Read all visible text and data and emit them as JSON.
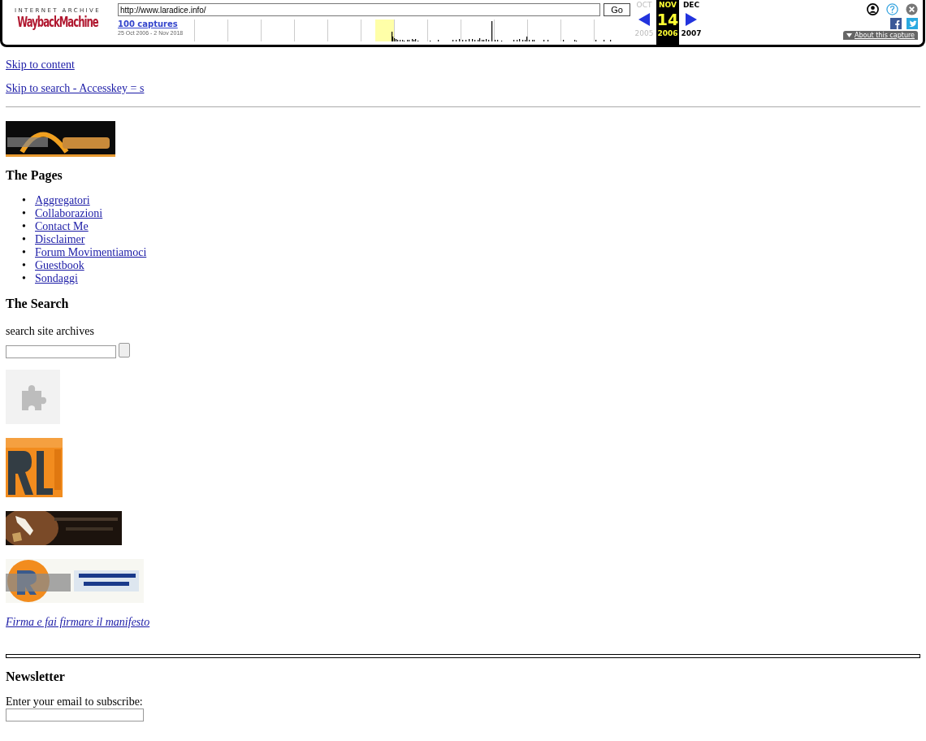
{
  "toolbar": {
    "brand_top": "INTERNET ARCHIVE",
    "brand_logo": "WaybackMachine",
    "url": "http://www.laradice.info/",
    "go_button": "Go",
    "captures_link": "100 captures",
    "date_range": "25 Oct 2006 - 2 Nov 2018",
    "months": [
      {
        "month": "OCT",
        "year": "2005",
        "selected": false,
        "disabled": true
      },
      {
        "month": "NOV",
        "day": "14",
        "year": "2006",
        "selected": true,
        "disabled": false
      },
      {
        "month": "DEC",
        "year": "2007",
        "selected": false,
        "disabled": false
      }
    ],
    "about_button": "About this capture"
  },
  "blocks": [
    {
      "kind": "link",
      "text": "Skip to content"
    },
    {
      "kind": "link",
      "text": "Skip to search - Accesskey = s"
    },
    {
      "kind": "rule"
    },
    {
      "kind": "picture"
    },
    {
      "kind": "heading",
      "text": "The Pages"
    },
    {
      "kind": "list",
      "items": [
        {
          "bullet": "•",
          "text": "Aggregatori"
        },
        {
          "bullet": "•",
          "text": "Collaborazioni"
        },
        {
          "bullet": "•",
          "text": "Contact Me"
        },
        {
          "bullet": "•",
          "text": "Disclaimer"
        },
        {
          "bullet": "•",
          "text": "Forum Movimentiamoci"
        },
        {
          "bullet": "•",
          "text": "Guestbook"
        },
        {
          "bullet": "•",
          "text": "Sondaggi"
        }
      ]
    },
    {
      "kind": "heading",
      "text": "The Search"
    },
    {
      "kind": "text",
      "text": "search site archives"
    },
    {
      "kind": "search"
    },
    {
      "kind": "plugin"
    },
    {
      "kind": "picture"
    },
    {
      "kind": "picture"
    },
    {
      "kind": "picture"
    },
    {
      "kind": "italic_link",
      "text": "Firma e fai firmare il manifesto"
    },
    {
      "kind": "thick_rule"
    },
    {
      "kind": "heading",
      "text": "Newsletter"
    },
    {
      "kind": "text",
      "text": "Enter your email to subscribe:"
    },
    {
      "kind": "email"
    }
  ]
}
